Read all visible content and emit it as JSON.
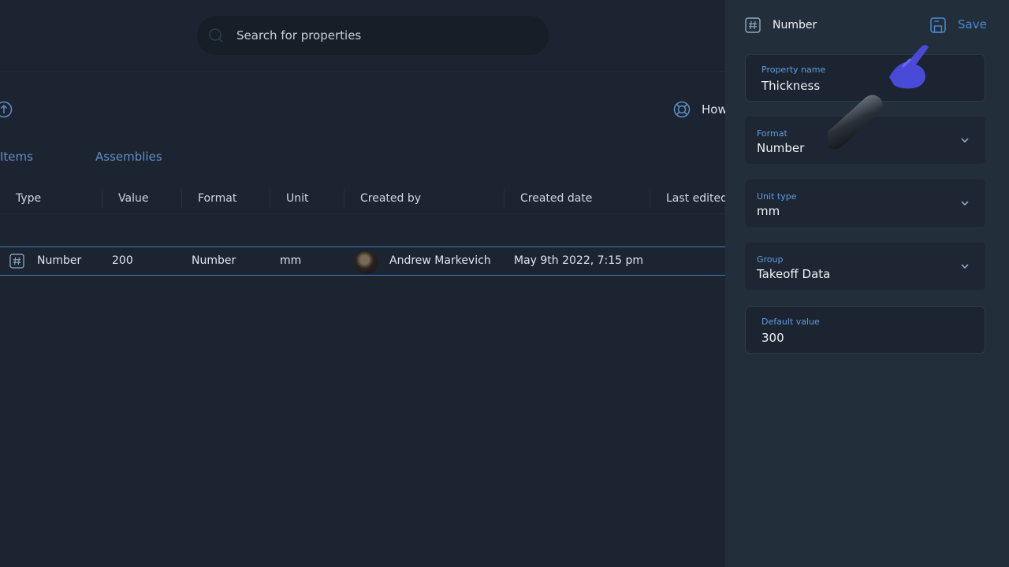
{
  "search": {
    "placeholder": "Search for properties",
    "icon": "search-icon"
  },
  "toolbar": {
    "help_label": "How"
  },
  "tabs": [
    {
      "label": "Items"
    },
    {
      "label": "Assemblies"
    }
  ],
  "table": {
    "columns": [
      "Type",
      "Value",
      "Format",
      "Unit",
      "Created by",
      "Created date",
      "Last edited b"
    ],
    "rows": [
      {
        "type": "Number",
        "value": "200",
        "format": "Number",
        "unit": "mm",
        "created_by": "Andrew Markevich",
        "created_date": "May 9th 2022, 7:15 pm"
      }
    ]
  },
  "panel": {
    "title": "Number",
    "save_label": "Save",
    "fields": {
      "property_name": {
        "label": "Property name",
        "value": "Thickness"
      },
      "format": {
        "label": "Format",
        "value": "Number"
      },
      "unit_type": {
        "label": "Unit type",
        "value": "mm"
      },
      "group": {
        "label": "Group",
        "value": "Takeoff Data"
      },
      "default_value": {
        "label": "Default value",
        "value": "300"
      }
    }
  },
  "colors": {
    "accent": "#4a8bd0",
    "background": "#1b2430",
    "panel": "#232e3b",
    "row_border": "#3b7fc0"
  }
}
